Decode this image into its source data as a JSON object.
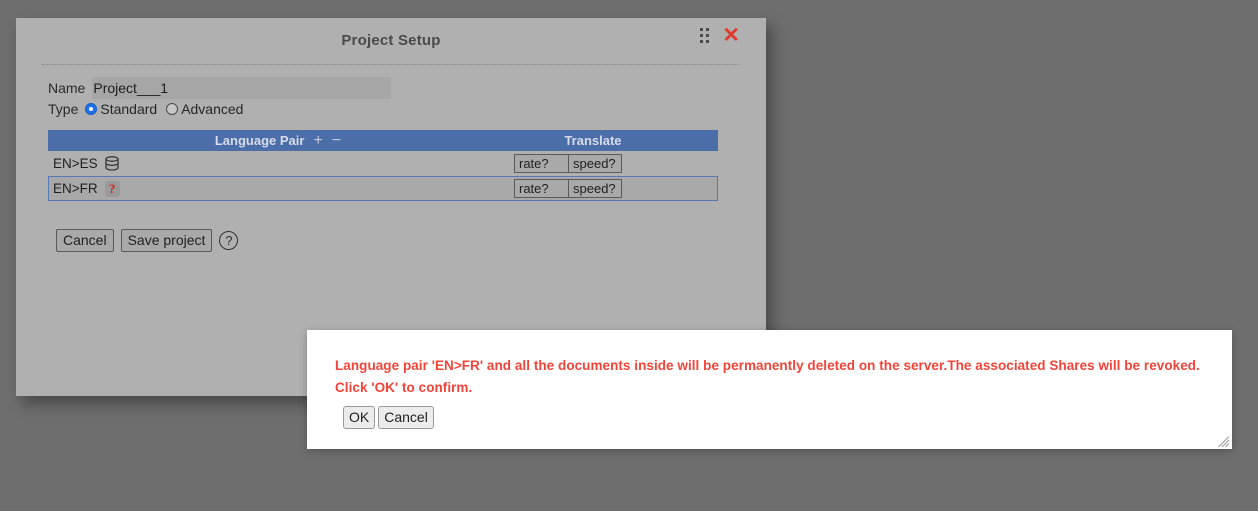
{
  "panel": {
    "title": "Project Setup",
    "drag_handle_icon": "drag-dots-icon",
    "close_icon": "close-x-icon",
    "name_label": "Name",
    "name_value": "Project___1",
    "name_placeholder": "",
    "type_label": "Type",
    "type_options": [
      {
        "label": "Standard",
        "checked": true
      },
      {
        "label": "Advanced",
        "checked": false
      }
    ],
    "table": {
      "columns": {
        "language_pair": "Language Pair",
        "translate": "Translate"
      },
      "add_icon": "plus-icon",
      "remove_icon": "minus-icon",
      "rows": [
        {
          "pair": "EN>ES",
          "status_icon": "database-icon",
          "rate_label": "rate?",
          "speed_label": "speed?",
          "selected": false
        },
        {
          "pair": "EN>FR",
          "status_icon": "question-badge-icon",
          "rate_label": "rate?",
          "speed_label": "speed?",
          "selected": true
        }
      ]
    },
    "footer": {
      "cancel_label": "Cancel",
      "save_label": "Save project",
      "help_icon": "help-circle-icon",
      "help_glyph": "?"
    }
  },
  "confirm_dialog": {
    "message_line1": "Language pair 'EN>FR' and all the documents inside will be permanently deleted on the server.The associated Shares will be revoked.",
    "message_line2": "Click 'OK' to confirm.",
    "ok_label": "OK",
    "cancel_label": "Cancel",
    "resize_icon": "resize-grip-icon"
  },
  "colors": {
    "background": "#6e6e6e",
    "panel": "#b0b0b0",
    "table_header": "#4c6ea8",
    "selected_row_border": "#5879b5",
    "alert_text": "#f24438",
    "close_x": "#e03b2f",
    "radio_checked": "#1a73e8"
  }
}
